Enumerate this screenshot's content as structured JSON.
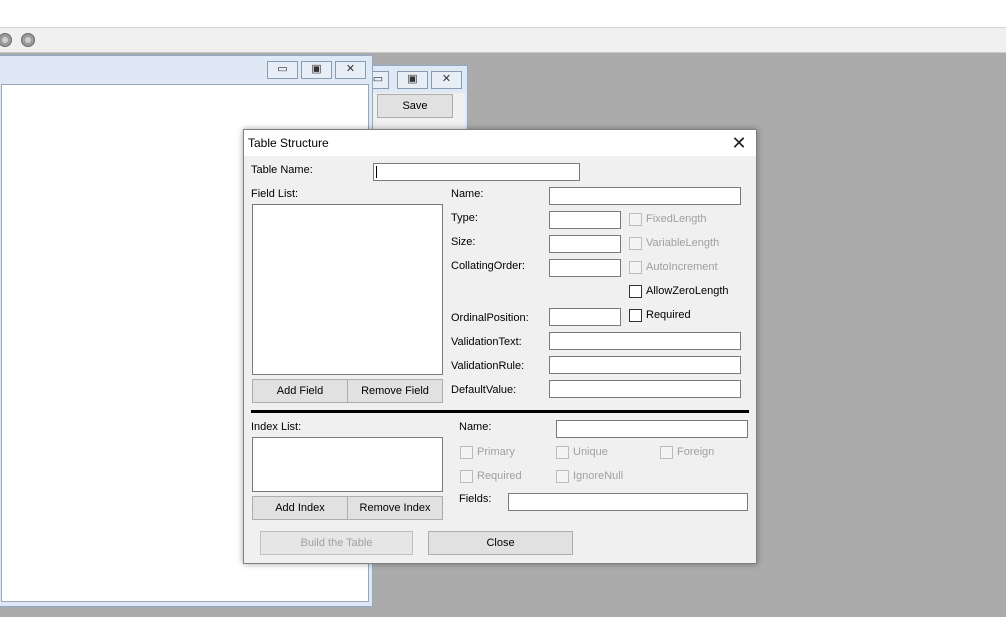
{
  "toolbar": {
    "icons": [
      "gear-icon",
      "gear-icon"
    ]
  },
  "back_window": {
    "save_label": "Save"
  },
  "dialog": {
    "title": "Table Structure",
    "close_glyph": "✕",
    "table_name_label": "Table Name:",
    "table_name_value": "",
    "field_list_label": "Field List:",
    "fields": {
      "name": "Name:",
      "type": "Type:",
      "size": "Size:",
      "collating_order": "CollatingOrder:",
      "ordinal_position": "OrdinalPosition:",
      "validation_text": "ValidationText:",
      "validation_rule": "ValidationRule:",
      "default_value": "DefaultValue:"
    },
    "field_checks": {
      "fixed_length": "FixedLength",
      "variable_length": "VariableLength",
      "auto_increment": "AutoIncrement",
      "allow_zero_length": "AllowZeroLength",
      "required": "Required"
    },
    "add_field": "Add Field",
    "remove_field": "Remove Field",
    "index_list_label": "Index List:",
    "index": {
      "name": "Name:",
      "primary": "Primary",
      "unique": "Unique",
      "foreign": "Foreign",
      "required": "Required",
      "ignore_null": "IgnoreNull",
      "fields": "Fields:"
    },
    "add_index": "Add Index",
    "remove_index": "Remove Index",
    "build_table": "Build the Table",
    "close": "Close"
  }
}
